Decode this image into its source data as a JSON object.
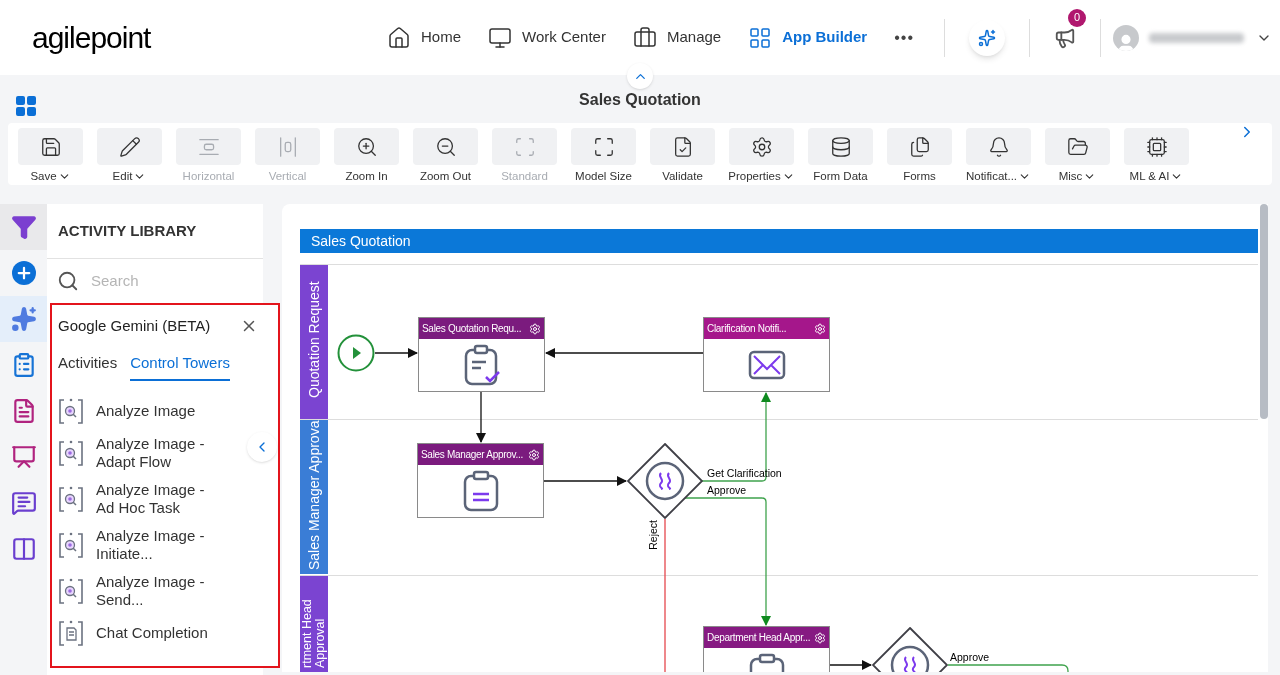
{
  "header": {
    "logo": "agilepoint",
    "nav": [
      {
        "label": "Home",
        "selected": false
      },
      {
        "label": "Work Center",
        "selected": false
      },
      {
        "label": "Manage",
        "selected": false
      },
      {
        "label": "App Builder",
        "selected": true
      }
    ],
    "more": "•••",
    "notification_count": "0"
  },
  "app_title": "Sales Quotation",
  "toolbar": [
    {
      "label": "Save",
      "dropdown": true,
      "disabled": false
    },
    {
      "label": "Edit",
      "dropdown": true,
      "disabled": false
    },
    {
      "label": "Horizontal",
      "dropdown": false,
      "disabled": true
    },
    {
      "label": "Vertical",
      "dropdown": false,
      "disabled": true
    },
    {
      "label": "Zoom In",
      "dropdown": false,
      "disabled": false
    },
    {
      "label": "Zoom Out",
      "dropdown": false,
      "disabled": false
    },
    {
      "label": "Standard",
      "dropdown": false,
      "disabled": true
    },
    {
      "label": "Model Size",
      "dropdown": false,
      "disabled": false
    },
    {
      "label": "Validate",
      "dropdown": false,
      "disabled": false
    },
    {
      "label": "Properties",
      "dropdown": true,
      "disabled": false
    },
    {
      "label": "Form Data",
      "dropdown": false,
      "disabled": false
    },
    {
      "label": "Forms",
      "dropdown": false,
      "disabled": false
    },
    {
      "label": "Notificat...",
      "dropdown": true,
      "disabled": false
    },
    {
      "label": "Misc",
      "dropdown": true,
      "disabled": false
    },
    {
      "label": "ML & AI",
      "dropdown": true,
      "disabled": false
    }
  ],
  "side_rail": [
    {
      "selected": false
    },
    {
      "selected": false
    },
    {
      "selected": true
    },
    {
      "selected": false
    },
    {
      "selected": false
    },
    {
      "selected": false
    },
    {
      "selected": false
    },
    {
      "selected": false
    }
  ],
  "library": {
    "title": "ACTIVITY LIBRARY",
    "search_placeholder": "Search",
    "group_title": "Google Gemini (BETA)",
    "tabs": [
      {
        "label": "Activities",
        "selected": false
      },
      {
        "label": "Control Towers",
        "selected": true
      }
    ],
    "items": [
      {
        "label": "Analyze Image",
        "kind": "image"
      },
      {
        "label": "Analyze Image - Adapt Flow",
        "kind": "image"
      },
      {
        "label": "Analyze Image - Ad Hoc Task",
        "kind": "image"
      },
      {
        "label": "Analyze Image - Initiate...",
        "kind": "image"
      },
      {
        "label": "Analyze Image - Send...",
        "kind": "image"
      },
      {
        "label": "Chat Completion",
        "kind": "document"
      }
    ]
  },
  "diagram": {
    "pool_title": "Sales Quotation",
    "lanes": [
      {
        "label": "Quotation Request",
        "color": "#7b44d1"
      },
      {
        "label": "Sales Manager Approva",
        "color": "#3a7dd6"
      },
      {
        "label": "rtment Head Approval",
        "color": "#7b44d1"
      }
    ],
    "nodes": [
      {
        "kind": "start"
      },
      {
        "kind": "form_task",
        "title": "Sales Quotation Requ...",
        "color": "#7b1b7e"
      },
      {
        "kind": "mail_task",
        "title": "Clarification Notifi...",
        "color": "#a5178b"
      },
      {
        "kind": "approval_task",
        "title": "Sales Manager Approv...",
        "color": "#7b1b7e"
      },
      {
        "kind": "gateway"
      },
      {
        "kind": "approval_task",
        "title": "Department Head Appr...",
        "color": "#861a82"
      },
      {
        "kind": "gateway"
      }
    ],
    "flow_labels": [
      "Get Clarification",
      "Approve",
      "Reject",
      "Approve"
    ]
  }
}
